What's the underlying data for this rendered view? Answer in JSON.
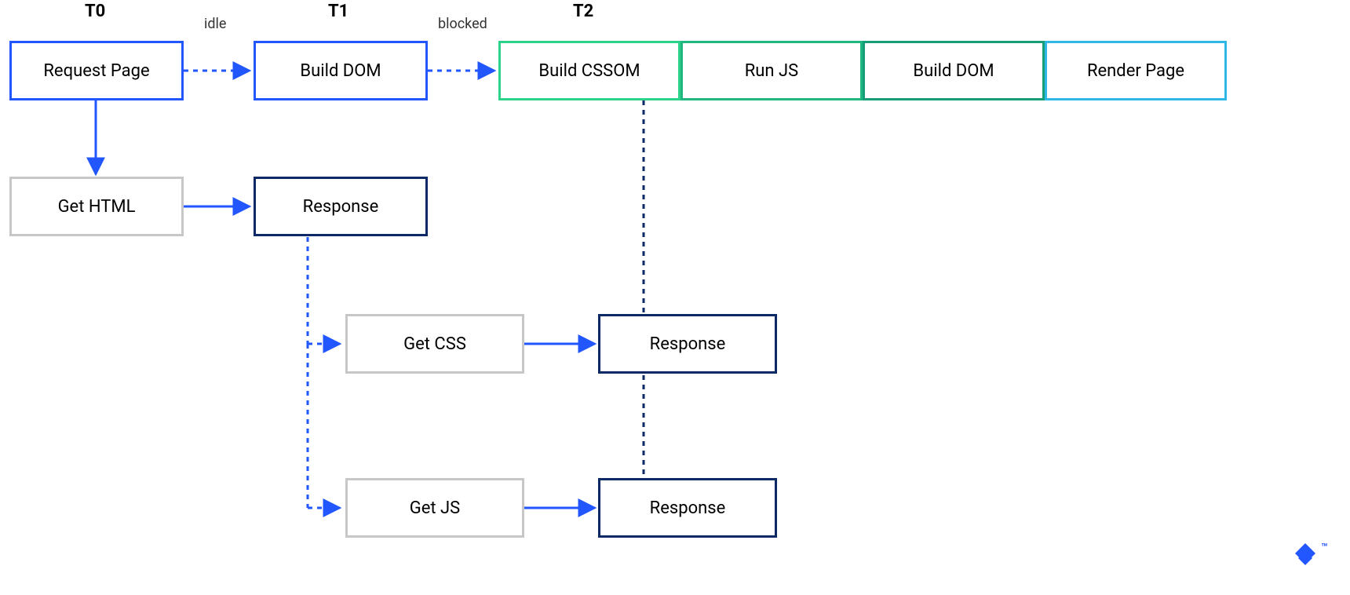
{
  "time_markers": {
    "t0": "T0",
    "t1": "T1",
    "t2": "T2"
  },
  "edge_labels": {
    "idle": "idle",
    "blocked": "blocked"
  },
  "boxes": {
    "request_page": "Request Page",
    "build_dom_1": "Build DOM",
    "build_cssom": "Build CSSOM",
    "run_js": "Run JS",
    "build_dom_2": "Build DOM",
    "render_page": "Render Page",
    "get_html": "Get HTML",
    "response_html": "Response",
    "get_css": "Get CSS",
    "response_css": "Response",
    "get_js": "Get JS",
    "response_js": "Response"
  },
  "colors": {
    "blue": "#2256ff",
    "navy": "#0d2a66",
    "grey": "#c7c7c7",
    "green_lt": "#2fd28b",
    "green": "#1fb680",
    "green_dk": "#159e78",
    "cyan": "#2fb7e6"
  },
  "brand_mark": "™"
}
